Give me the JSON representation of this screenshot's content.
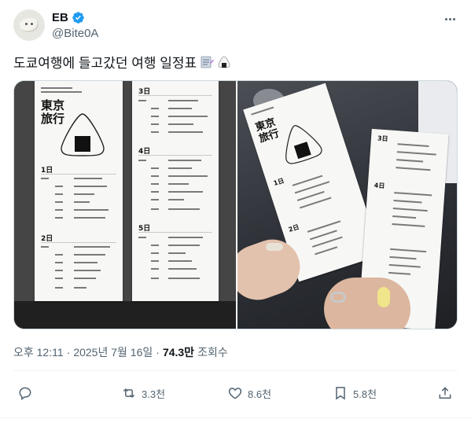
{
  "author": {
    "display_name": "EB",
    "handle": "@Bite0A",
    "verified": true,
    "avatar_icon": "avatar-image",
    "verified_color": "#1d9bf0"
  },
  "tweet": {
    "text": "도쿄여행에 들고갔던 여행 일정표"
  },
  "media": {
    "left_image": {
      "title_lines": [
        "東京",
        "旅行"
      ],
      "day_labels": [
        "1日",
        "2日",
        "3日",
        "4日",
        "5日"
      ]
    },
    "right_image": {
      "title_lines": [
        "東京",
        "旅行"
      ],
      "day_labels": [
        "1日",
        "2日",
        "3日",
        "4日"
      ]
    }
  },
  "meta": {
    "time": "오후 12:11",
    "dot": "·",
    "date": "2025년 7월 16일",
    "views_count": "74.3만",
    "views_label": "조회수"
  },
  "actions": {
    "reply": {
      "label": "",
      "icon": "reply-icon"
    },
    "retweet": {
      "label": "3.3천",
      "icon": "retweet-icon"
    },
    "like": {
      "label": "8.6천",
      "icon": "heart-icon"
    },
    "bookmark": {
      "label": "5.8천",
      "icon": "bookmark-icon"
    },
    "share": {
      "label": "",
      "icon": "share-icon"
    }
  },
  "colors": {
    "text_primary": "#0f1419",
    "text_secondary": "#536471",
    "border": "#eff3f4"
  }
}
